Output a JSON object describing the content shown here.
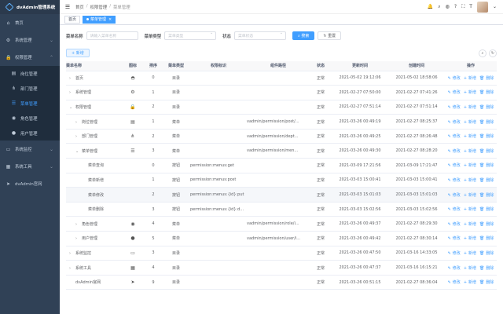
{
  "app": {
    "title": "dvAdmin管理系统"
  },
  "sidebar": {
    "items": [
      {
        "label": "首页",
        "icon": "dashboard-icon",
        "glyph": "⌂"
      },
      {
        "label": "系统管理",
        "icon": "gear-icon",
        "glyph": "⚙",
        "arrow": "⌄"
      },
      {
        "label": "权限管理",
        "icon": "lock-icon",
        "glyph": "🔒",
        "arrow": "⌃"
      }
    ],
    "subitems": [
      {
        "label": "岗位管理",
        "icon": "post-icon",
        "glyph": "▤"
      },
      {
        "label": "部门管理",
        "icon": "tree-icon",
        "glyph": "⋔"
      },
      {
        "label": "菜单管理",
        "icon": "menu-icon",
        "glyph": "☰",
        "active": true
      },
      {
        "label": "角色管理",
        "icon": "role-icon",
        "glyph": "◉"
      },
      {
        "label": "用户管理",
        "icon": "user-icon",
        "glyph": "●"
      }
    ],
    "after": [
      {
        "label": "系统监控",
        "icon": "monitor-icon",
        "glyph": "▭",
        "arrow": "⌄"
      },
      {
        "label": "系统工具",
        "icon": "tools-icon",
        "glyph": "▦",
        "arrow": "⌄"
      },
      {
        "label": "dvAdmin官网",
        "icon": "send-icon",
        "glyph": "➤"
      }
    ]
  },
  "navbar": {
    "breadcrumb": [
      "首页",
      "权限管理",
      "菜单管理"
    ]
  },
  "tags": {
    "home": "首页",
    "current": "菜单管理"
  },
  "filters": {
    "menu_name_label": "菜单名称",
    "menu_name_placeholder": "请输入菜单名称",
    "menu_type_label": "菜单类型",
    "menu_type_placeholder": "菜单类型",
    "status_label": "状态",
    "status_placeholder": "菜单状态",
    "search": "搜索",
    "reset": "重置"
  },
  "toolbar": {
    "add": "新增"
  },
  "table": {
    "headers": [
      "菜单名称",
      "图标",
      "排序",
      "菜单类型",
      "权限标识",
      "组件路径",
      "状态",
      "更新时间",
      "创建时间",
      "操作"
    ],
    "ops": {
      "edit": "修改",
      "add": "新增",
      "del": "删除"
    },
    "rows": [
      {
        "indent": 0,
        "exp": "›",
        "name": "首页",
        "icon": "◓",
        "sort": "0",
        "type": "目录",
        "perm": "",
        "path": "",
        "status": "正常",
        "upd": "2021-05-02 19:12:06",
        "crt": "2021-05-02 18:58:06"
      },
      {
        "indent": 0,
        "exp": "›",
        "name": "系统管理",
        "icon": "⚙",
        "sort": "1",
        "type": "目录",
        "perm": "",
        "path": "",
        "status": "正常",
        "upd": "2021-02-27 07:50:00",
        "crt": "2021-02-27 07:41:26"
      },
      {
        "indent": 0,
        "exp": "⌄",
        "name": "权限管理",
        "icon": "🔒",
        "sort": "2",
        "type": "目录",
        "perm": "",
        "path": "",
        "status": "正常",
        "upd": "2021-02-27 07:51:14",
        "crt": "2021-02-27 07:51:14"
      },
      {
        "indent": 1,
        "exp": "›",
        "name": "岗位管理",
        "icon": "▤",
        "sort": "1",
        "type": "菜单",
        "perm": "",
        "path": "vadmin/permission/post/...",
        "status": "正常",
        "upd": "2021-03-26 00:49:19",
        "crt": "2021-02-27 08:25:37"
      },
      {
        "indent": 1,
        "exp": "›",
        "name": "部门管理",
        "icon": "⋔",
        "sort": "2",
        "type": "菜单",
        "perm": "",
        "path": "vadmin/permission/dept...",
        "status": "正常",
        "upd": "2021-03-26 00:49:25",
        "crt": "2021-02-27 08:26:48"
      },
      {
        "indent": 1,
        "exp": "⌄",
        "name": "菜单管理",
        "icon": "☰",
        "sort": "3",
        "type": "菜单",
        "perm": "",
        "path": "vadmin/permission/men...",
        "status": "正常",
        "upd": "2021-03-26 00:49:30",
        "crt": "2021-02-27 08:28:20"
      },
      {
        "indent": 2,
        "exp": "",
        "name": "菜单查询",
        "icon": "",
        "sort": "0",
        "type": "按钮",
        "perm": "permission:menus:get",
        "path": "",
        "status": "正常",
        "upd": "2021-03-09 17:21:56",
        "crt": "2021-03-09 17:21:47"
      },
      {
        "indent": 2,
        "exp": "",
        "name": "菜单新增",
        "icon": "",
        "sort": "1",
        "type": "按钮",
        "perm": "permission:menus:post",
        "path": "",
        "status": "正常",
        "upd": "2021-03-03 15:00:41",
        "crt": "2021-03-03 15:00:41"
      },
      {
        "indent": 2,
        "exp": "",
        "name": "菜单修改",
        "icon": "",
        "sort": "2",
        "type": "按钮",
        "perm": "permission:menus:{id}:put",
        "path": "",
        "status": "正常",
        "upd": "2021-03-03 15:01:03",
        "crt": "2021-03-03 15:01:03",
        "hl": true
      },
      {
        "indent": 2,
        "exp": "",
        "name": "菜单删除",
        "icon": "",
        "sort": "3",
        "type": "按钮",
        "perm": "permission:menus:{id}:d...",
        "path": "",
        "status": "正常",
        "upd": "2021-03-03 15:02:56",
        "crt": "2021-03-03 15:02:56"
      },
      {
        "indent": 1,
        "exp": "›",
        "name": "角色管理",
        "icon": "◉",
        "sort": "4",
        "type": "菜单",
        "perm": "",
        "path": "vadmin/permission/role/i...",
        "status": "正常",
        "upd": "2021-03-26 00:49:37",
        "crt": "2021-02-27 08:29:30"
      },
      {
        "indent": 1,
        "exp": "›",
        "name": "用户管理",
        "icon": "●",
        "sort": "5",
        "type": "菜单",
        "perm": "",
        "path": "vadmin/permission/user/i...",
        "status": "正常",
        "upd": "2021-03-26 00:49:42",
        "crt": "2021-02-27 08:30:14"
      },
      {
        "indent": 0,
        "exp": "›",
        "name": "系统监控",
        "icon": "▭",
        "sort": "3",
        "type": "目录",
        "perm": "",
        "path": "",
        "status": "正常",
        "upd": "2021-03-26 00:47:50",
        "crt": "2021-03-16 14:33:05"
      },
      {
        "indent": 0,
        "exp": "›",
        "name": "系统工具",
        "icon": "▦",
        "sort": "4",
        "type": "目录",
        "perm": "",
        "path": "",
        "status": "正常",
        "upd": "2021-03-26 00:47:37",
        "crt": "2021-03-16 16:15:21"
      },
      {
        "indent": 0,
        "exp": "",
        "name": "dvAdmin官网",
        "icon": "➤",
        "sort": "9",
        "type": "目录",
        "perm": "",
        "path": "",
        "status": "正常",
        "upd": "2021-03-26 00:51:15",
        "crt": "2021-02-27 08:36:04"
      }
    ]
  }
}
